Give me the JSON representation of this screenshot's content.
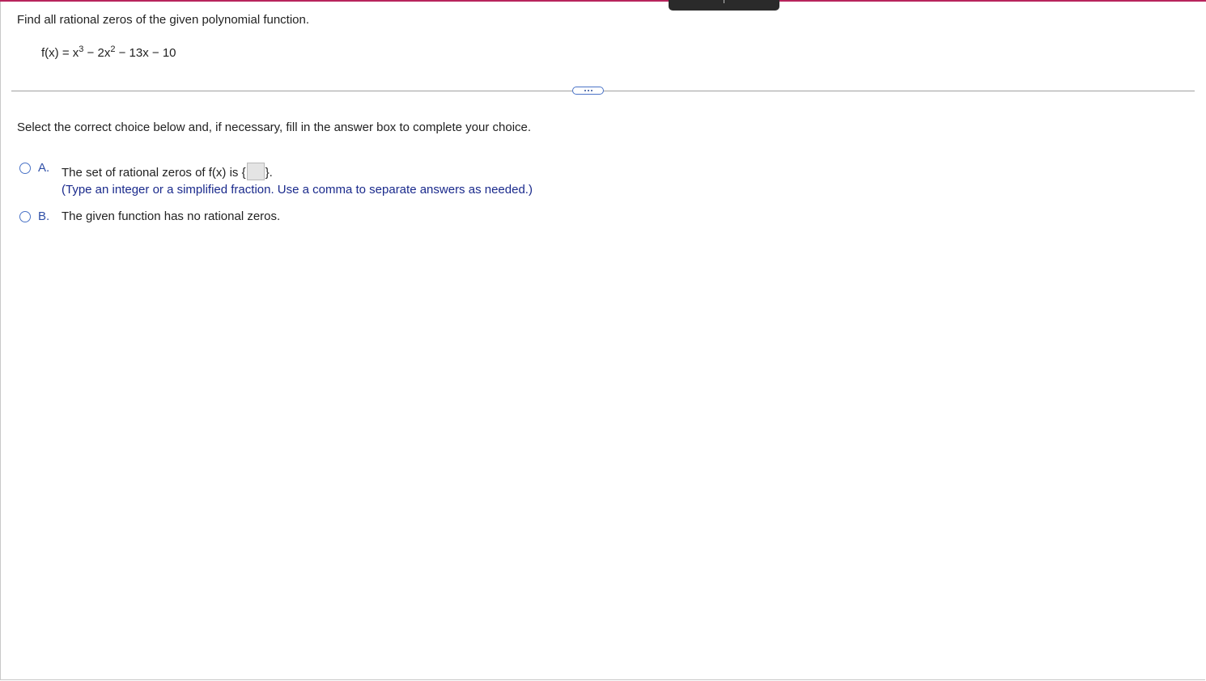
{
  "question": {
    "prompt": "Find all rational zeros of the given polynomial function.",
    "function": {
      "lhs": "f(x) = x",
      "exp1": "3",
      "mid": " − 2x",
      "exp2": "2",
      "rest": " − 13x − 10"
    }
  },
  "instruction": "Select the correct choice below and, if necessary, fill in the answer box to complete your choice.",
  "choices": [
    {
      "letter": "A.",
      "text_before": "The set of rational zeros of f(x) is ",
      "brace_open": "{",
      "brace_close": "}",
      "text_after": ".",
      "answer_value": "",
      "hint": "(Type an integer or a simplified fraction. Use a comma to separate answers as needed.)"
    },
    {
      "letter": "B.",
      "text": "The given function has no rational zeros."
    }
  ],
  "colors": {
    "accent": "#b8245c",
    "choice_letter": "#2f4fa7",
    "hint_text": "#1a2a8c",
    "radio_border": "#4a73c7"
  },
  "icons": {
    "expand": "more-horizontal-icon"
  }
}
